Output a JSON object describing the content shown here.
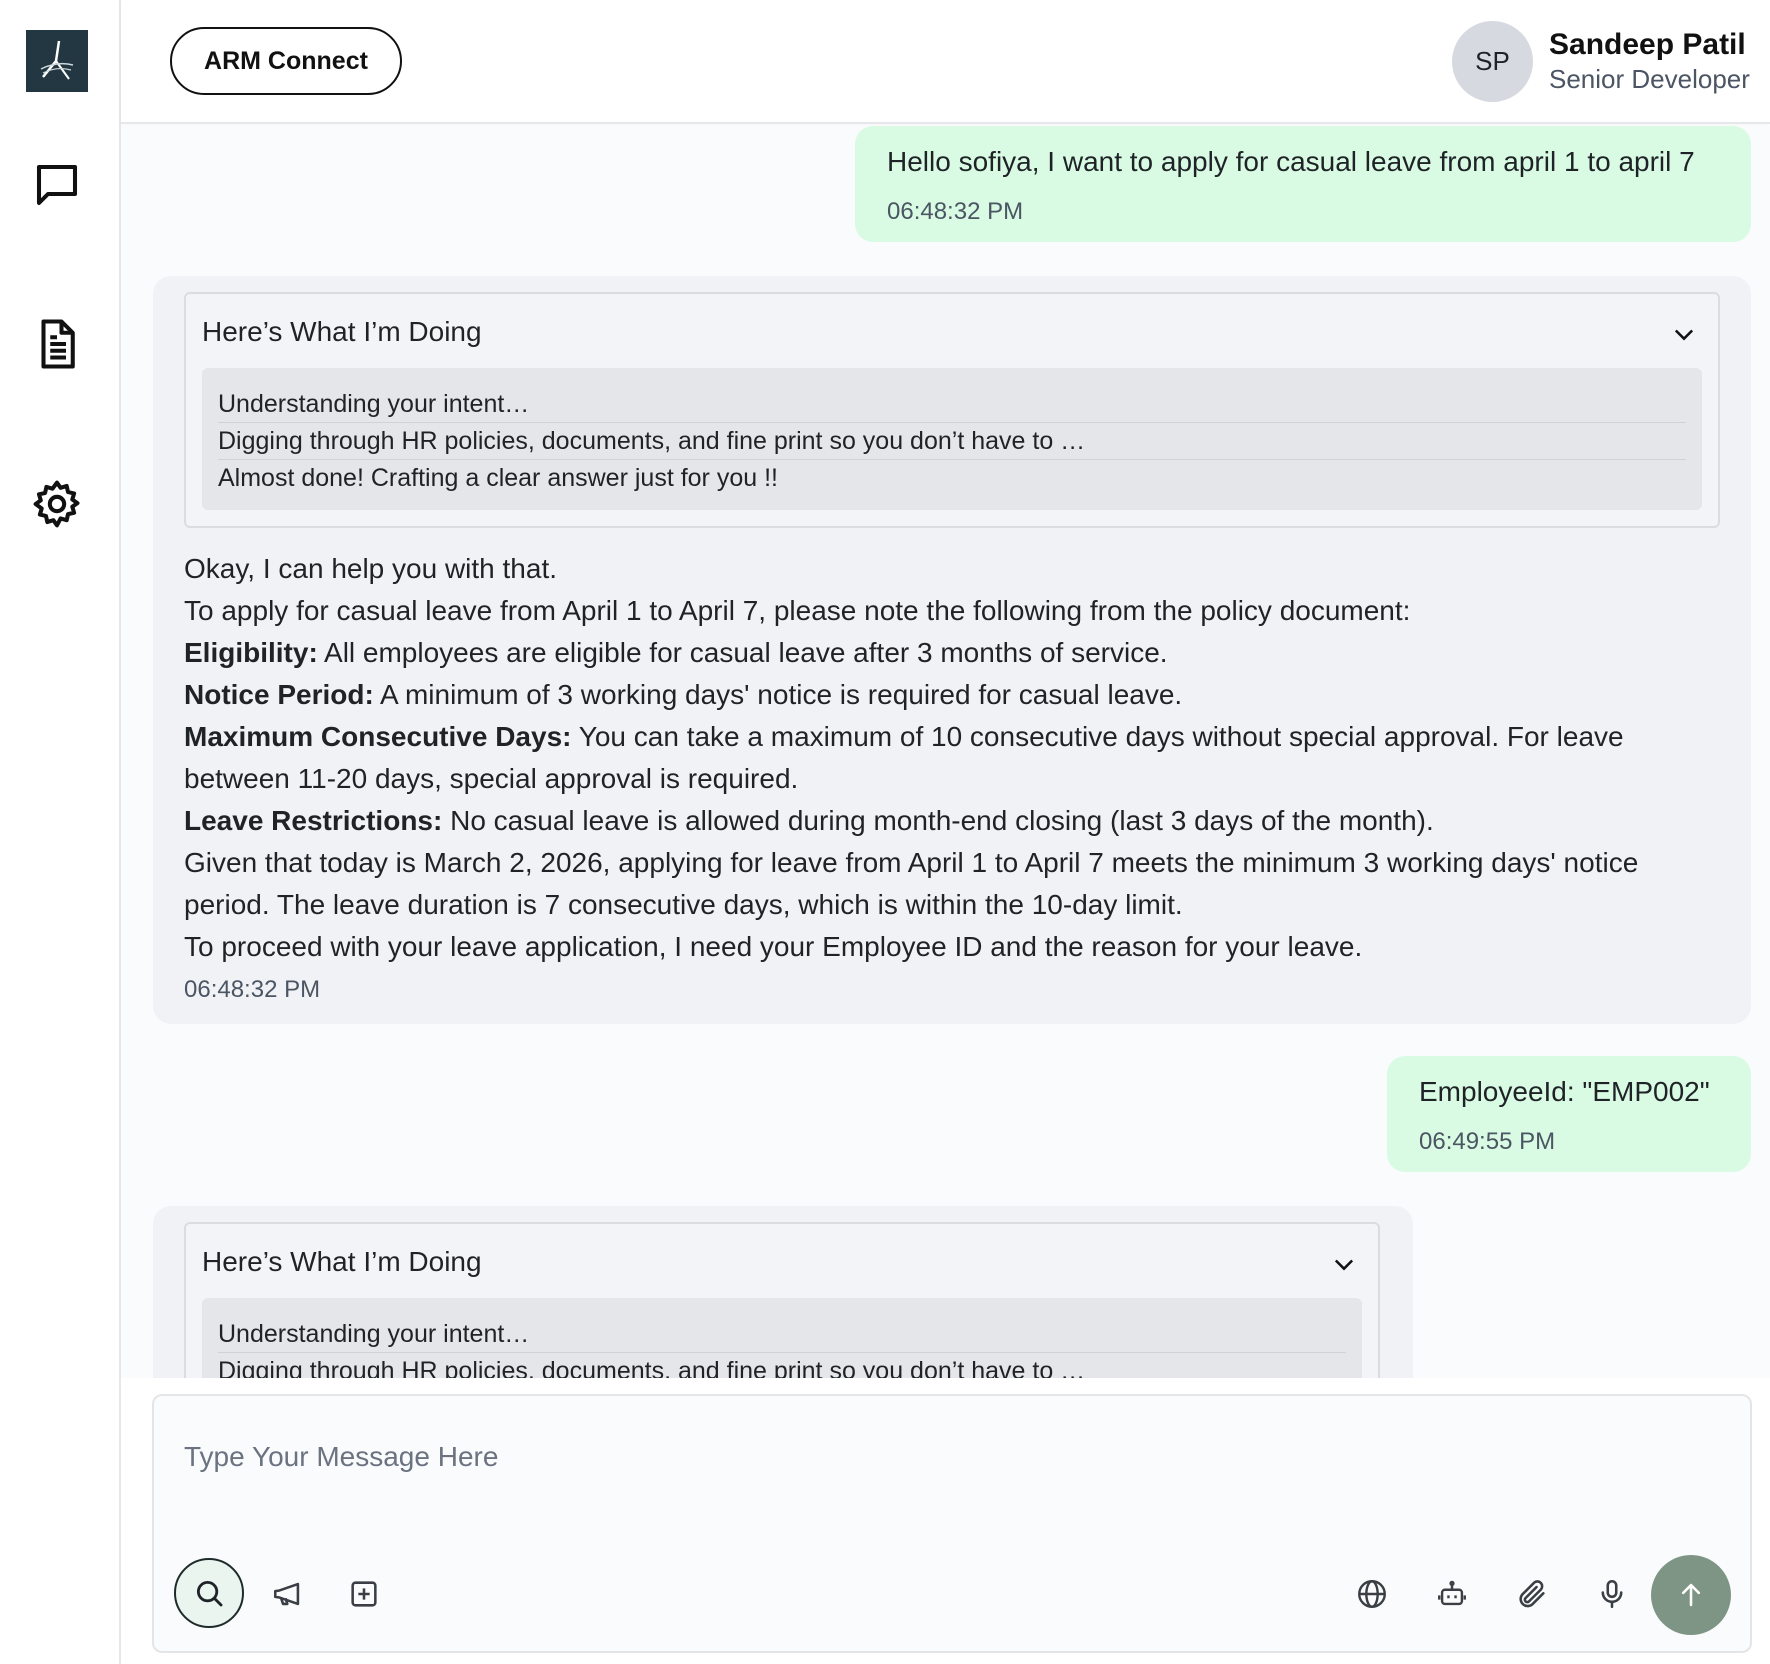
{
  "sidebar": {
    "icons": [
      "app-logo",
      "chat-icon",
      "document-icon",
      "settings-icon"
    ]
  },
  "header": {
    "app_button_label": "ARM Connect",
    "user": {
      "initials": "SP",
      "name": "Sandeep Patil",
      "role": "Senior Developer"
    }
  },
  "messages": [
    {
      "type": "user",
      "text": "Hello sofiya, I want to apply for casual leave from april 1 to april 7",
      "time": "06:48:32 PM"
    },
    {
      "type": "bot",
      "thinking_title": "Here’s What I’m Doing",
      "steps": [
        "Understanding your intent…",
        "Digging through HR policies, documents, and fine print so you don’t have to …",
        "Almost done! Crafting a clear answer just for you !!"
      ],
      "answer": {
        "intro": "Okay, I can help you with that.",
        "context": "To apply for casual leave from April 1 to April 7, please note the following from the policy document:",
        "points": [
          {
            "label": "Eligibility:",
            "text": " All employees are eligible for casual leave after 3 months of service."
          },
          {
            "label": "Notice Period:",
            "text": " A minimum of 3 working days' notice is required for casual leave."
          },
          {
            "label": "Maximum Consecutive Days:",
            "text": " You can take a maximum of 10 consecutive days without special approval. For leave between 11-20 days, special approval is required."
          },
          {
            "label": "Leave Restrictions:",
            "text": " No casual leave is allowed during month-end closing (last 3 days of the month)."
          }
        ],
        "summary": "Given that today is March 2, 2026, applying for leave from April 1 to April 7 meets the minimum 3 working days' notice period. The leave duration is 7 consecutive days, which is within the 10-day limit.",
        "request": "To proceed with your leave application, I need your Employee ID and the reason for your leave."
      },
      "time": "06:48:32 PM"
    },
    {
      "type": "user",
      "text": "EmployeeId: \"EMP002\"",
      "time": "06:49:55 PM"
    },
    {
      "type": "bot",
      "thinking_title": "Here’s What I’m Doing",
      "steps": [
        "Understanding your intent…",
        "Digging through HR policies, documents, and fine print so you don’t have to …"
      ]
    }
  ],
  "composer": {
    "placeholder": "Type Your Message Here",
    "tools_left": [
      "search-icon",
      "megaphone-icon",
      "add-square-icon"
    ],
    "tools_right": [
      "globe-icon",
      "bot-icon",
      "paperclip-icon",
      "microphone-icon"
    ],
    "send_icon": "arrow-up-icon"
  },
  "colors": {
    "user_bubble": "#d9fbe3",
    "bot_bubble": "#f1f2f5",
    "send_button": "#7e9585",
    "logo_bg": "#233743"
  }
}
